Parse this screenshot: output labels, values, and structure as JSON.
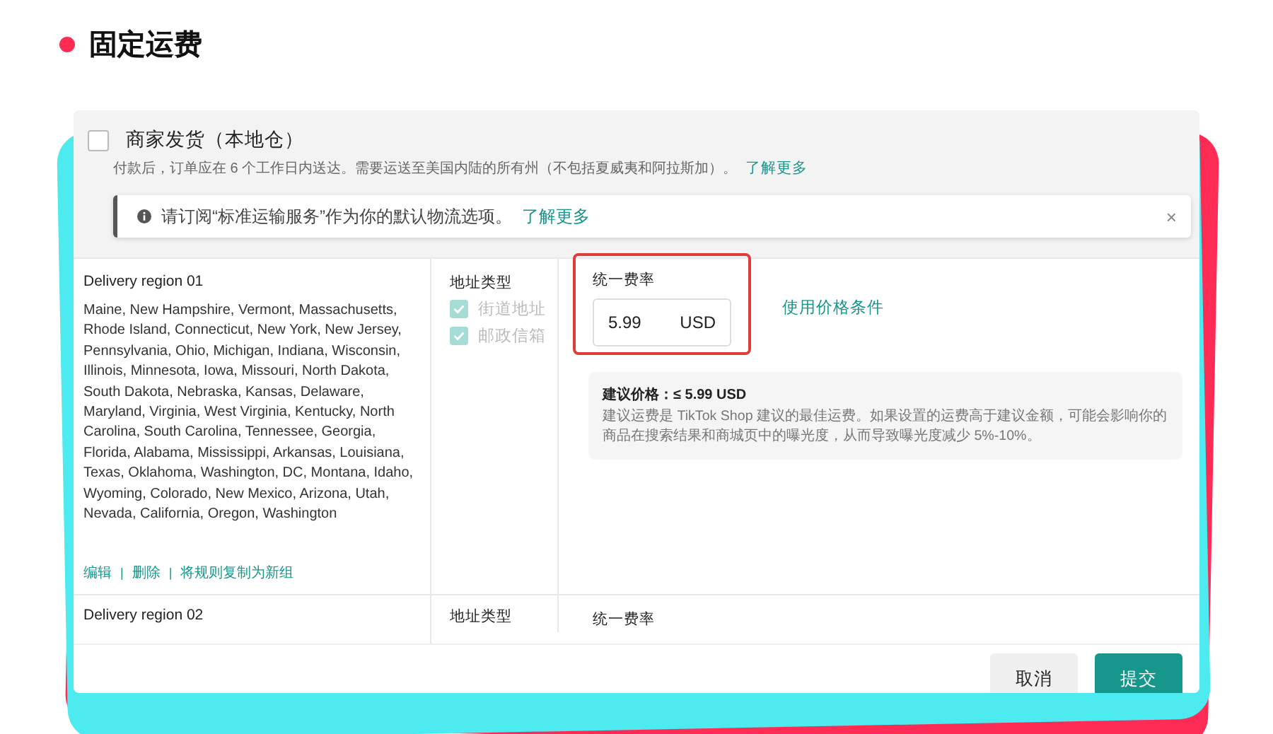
{
  "page_title": "固定运费",
  "option": {
    "checked": false,
    "title": "商家发货（本地仓）",
    "description": "付款后，订单应在 6 个工作日内送达。需要运送至美国内陆的所有州（不包括夏威夷和阿拉斯加）。",
    "learn_more": "了解更多"
  },
  "notice": {
    "text": "请订阅“标准运输服务”作为你的默认物流选项。",
    "link": "了解更多",
    "close": "×"
  },
  "regions": [
    {
      "name": "Delivery region 01",
      "states": "Maine, New Hampshire, Vermont, Massachusetts, Rhode Island, Connecticut, New York, New Jersey, Pennsylvania, Ohio, Michigan, Indiana, Wisconsin, Illinois, Minnesota, Iowa, Missouri, North Dakota, South Dakota, Nebraska, Kansas, Delaware, Maryland, Virginia, West Virginia, Kentucky, North Carolina, South Carolina, Tennessee, Georgia, Florida, Alabama, Mississippi, Arkansas, Louisiana, Texas, Oklahoma, Washington, DC, Montana, Idaho, Wyoming, Colorado, New Mexico, Arizona, Utah, Nevada, California, Oregon, Washington",
      "actions": [
        {
          "kind": "link",
          "label": "编辑"
        },
        {
          "kind": "separator",
          "label": "|"
        },
        {
          "kind": "link",
          "label": "删除"
        },
        {
          "kind": "separator",
          "label": "|"
        },
        {
          "kind": "link",
          "label": "将规则复制为新组"
        }
      ],
      "address_type_label": "地址类型",
      "address_types": [
        {
          "label": "街道地址",
          "checked": true,
          "disabled": true
        },
        {
          "label": "邮政信箱",
          "checked": true,
          "disabled": true
        }
      ],
      "rate_label": "统一费率",
      "rate": {
        "value": "5.99",
        "currency": "USD",
        "highlighted": true
      },
      "price_conditions_link": "使用价格条件",
      "suggestion": {
        "title": "建议价格：≤ 5.99 USD",
        "text": "建议运费是 TikTok Shop 建议的最佳运费。如果设置的运费高于建议金额，可能会影响你的商品在搜索结果和商城页中的曝光度，从而导致曝光度减少 5%-10%。"
      }
    },
    {
      "name": "Delivery region 02",
      "address_type_label": "地址类型",
      "rate_label": "统一费率"
    }
  ],
  "buttons": [
    {
      "label": "取消",
      "kind": "secondary"
    },
    {
      "label": "提交",
      "kind": "primary"
    }
  ]
}
